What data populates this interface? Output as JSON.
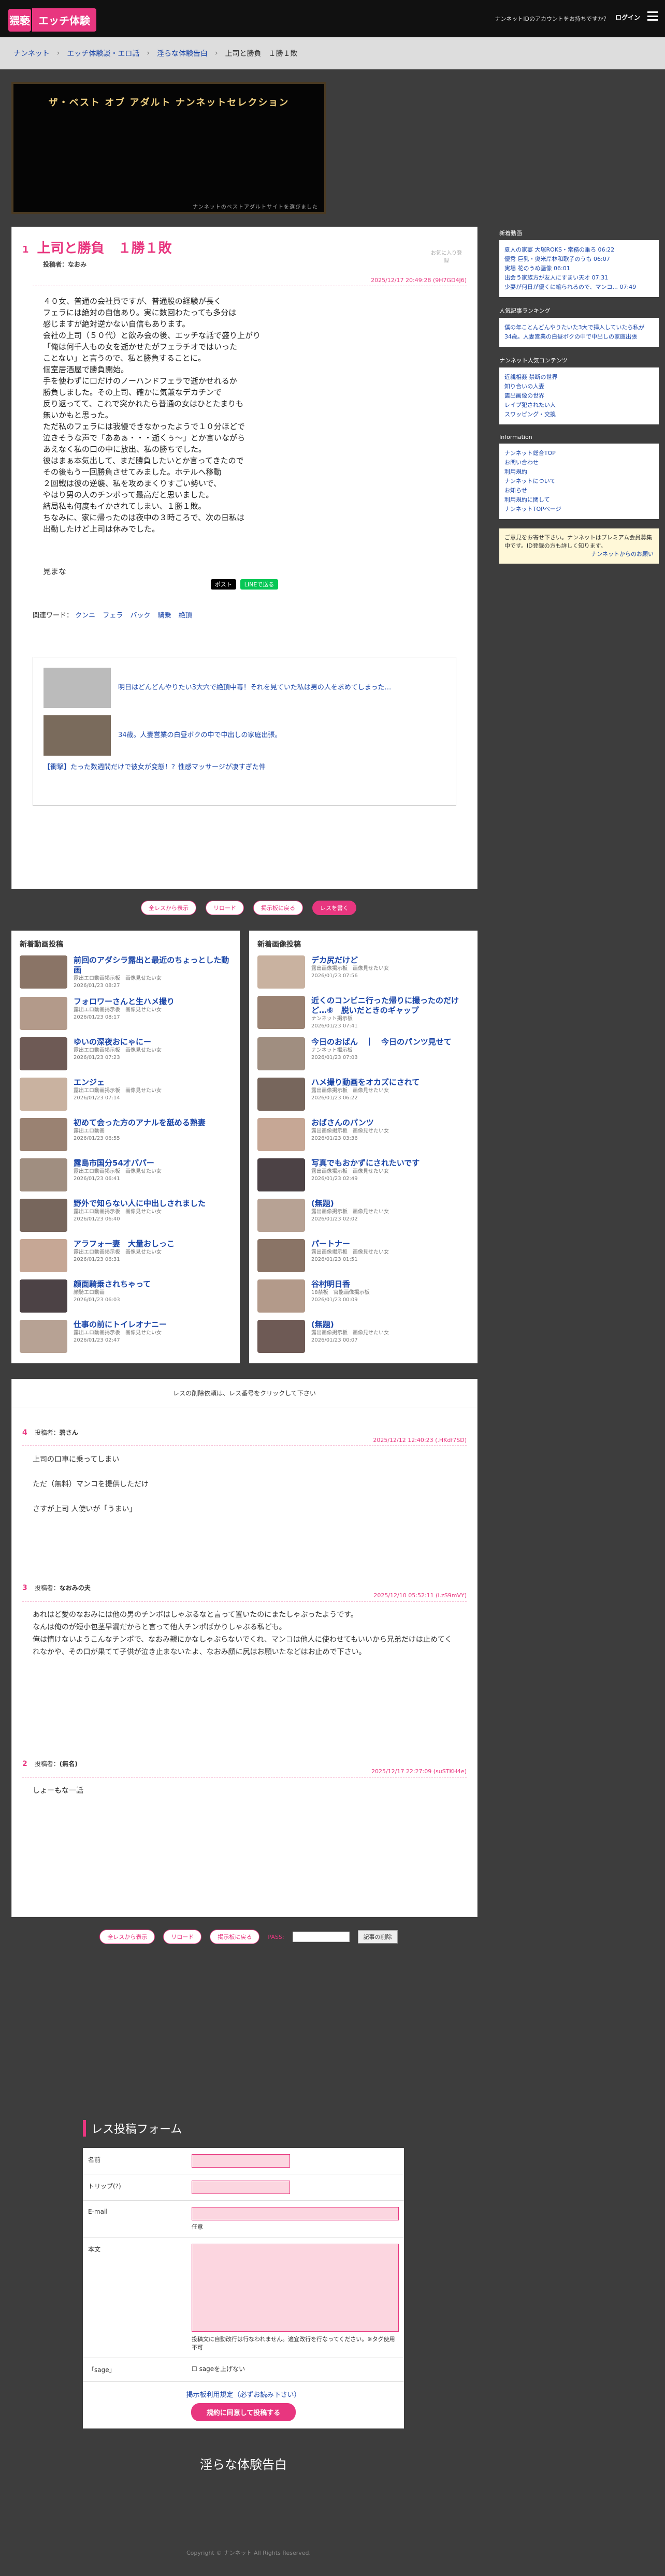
{
  "header": {
    "logo_mark": "猥褻",
    "logo_text": "エッチ体験",
    "message": "ナンネットIDのアカウントをお持ちですか？",
    "login": "ログイン"
  },
  "breadcrumb": [
    "ナンネット",
    "エッチ体験談・エロ話",
    "淫らな体験告白",
    "上司と勝負　１勝１敗"
  ],
  "banner": {
    "title": "ザ・ベスト オブ アダルト ナンネットセレクション",
    "footer": "ナンネットのベストアダルトサイトを選びました"
  },
  "article": {
    "num": "1",
    "title": "上司と勝負　１勝１敗",
    "poster_label": "投稿者：",
    "poster": "なおみ",
    "fav": "お気に入り登録",
    "date": "2025/12/17 20:49:28 (9H7GD4J6)",
    "body": "４０女、普通の会社員ですが、普通股の経験が長く\nフェラには絶対の自信あり。実に数回わたっても多分は\n感じますが絶対逆かない自信もあります。\n会社の上司（５０代）と飲み会の後、エッチな話で盛り上がり\n「俺は何千人もの女を逝かせたがフェラチオではいった\nことない」と言うので、私と勝負することに。\n個室居酒屋で勝負開始。\n手を使わずに口だけのノーハンドフェラで逝かせれるか\n勝負しました。その上司、確かに気兼なデカチンで\n反り返ってて、これで突かれたら普通の女はひとたまりも\n無いかもと思った。\nただ私のフェラには我慢できなかったようで１０分ほどで\n泣きそうな声で「ああぁ・・・逝くぅ～」とか言いながら\nあえなく私の口の中に放出、私の勝ちでした。\n彼はまぁ本気出して、まだ勝負したいとか言ってきたので\nその後もう一回勝負させてみました。ホテルへ移動\n２回戦は彼の逆襲、私を攻めまくりすごい勢いで、\nやはり男の人のチンポって最高だと思いました。\n結局私も何度もイかされてしまい、１勝１敗。\nちなみに、家に帰ったのは夜中の３時ころで、次の日私は\n出勤したけど上司は休みでした。",
    "sign": "見まな",
    "keywords_label": "関連ワード：",
    "keywords": [
      "クンニ",
      "フェラ",
      "バック",
      "騎乗",
      "絶頂"
    ]
  },
  "share": {
    "post": "ポスト",
    "line": "LINEで送る"
  },
  "ads": [
    "明日はどんどんやりたい3大穴で絶頂中毒！それを見ていた私は男の人を求めてしまった…",
    "34歳。人妻営業の白昼ボクの中で中出しの家庭出張。",
    "【衝撃】たった数週間だけで彼女が変態！？性感マッサージが凄すぎた件"
  ],
  "nav": {
    "all": "全レスから表示",
    "reload": "リロード",
    "back": "掲示板に戻る",
    "reply": "レスを書く"
  },
  "new_posts": {
    "title": "新着動画投稿",
    "items": [
      {
        "title": "前回のアダシラ露出と最近のちょっとした動画",
        "meta": "露出エロ動画掲示板　画像見せたい女",
        "date": "2026/01/23 08:27"
      },
      {
        "title": "フォロワーさんと生ハメ撮り",
        "meta": "露出エロ動画掲示板　画像見せたい女",
        "date": "2026/01/23 08:17"
      },
      {
        "title": "ゆいの深夜おにゃにー",
        "meta": "露出エロ動画掲示板　画像見せたい女",
        "date": "2026/01/23 07:23"
      },
      {
        "title": "エンジェ",
        "meta": "露出エロ動画掲示板　画像見せたい女",
        "date": "2026/01/23 07:14"
      },
      {
        "title": "初めて会った方のアナルを舐める熟妻",
        "meta": "露出エロ動画",
        "date": "2026/01/23 06:55"
      },
      {
        "title": "露島市国分54才パパー",
        "meta": "露出エロ動画掲示板　画像見せたい女",
        "date": "2026/01/23 06:41"
      },
      {
        "title": "野外で知らない人に中出しされました",
        "meta": "露出エロ動画掲示板　画像見せたい女",
        "date": "2026/01/23 06:40"
      },
      {
        "title": "アラフォー妻　大量おしっこ",
        "meta": "露出エロ動画掲示板　画像見せたい女",
        "date": "2026/01/23 06:31"
      },
      {
        "title": "顔面騎乗されちゃって",
        "meta": "顔騎エロ動画",
        "date": "2026/01/23 06:03"
      },
      {
        "title": "仕事の前にトイレオナニー",
        "meta": "露出エロ動画掲示板　画像見せたい女",
        "date": "2026/01/23 02:47"
      }
    ]
  },
  "new_images": {
    "title": "新着画像投稿",
    "items": [
      {
        "title": "デカ尻だけど",
        "meta": "露出画像掲示板　画像見せたい女",
        "date": "2026/01/23 07:56"
      },
      {
        "title": "近くのコンビニ行った帰りに撮ったのだけど…⑥　脱いだときのギャップ",
        "meta": "ナンネット掲示板",
        "date": "2026/01/23 07:41"
      },
      {
        "title": "今日のおぱん　｜　今日のパンツ見せて",
        "meta": "ナンネット掲示板",
        "date": "2026/01/23 07:03"
      },
      {
        "title": "ハメ撮り動画をオカズにされて",
        "meta": "露出画像掲示板　画像見せたい女",
        "date": "2026/01/23 06:22"
      },
      {
        "title": "おばさんのパンツ",
        "meta": "露出画像掲示板　画像見せたい女",
        "date": "2026/01/23 03:36"
      },
      {
        "title": "写真でもおかずにされたいです",
        "meta": "露出画像掲示板　画像見せたい女",
        "date": "2026/01/23 02:49"
      },
      {
        "title": "(無題)",
        "meta": "露出画像掲示板　画像見せたい女",
        "date": "2026/01/23 02:02"
      },
      {
        "title": "パートナー",
        "meta": "露出画像掲示板　画像見せたい女",
        "date": "2026/01/23 01:51"
      },
      {
        "title": "谷村明日香",
        "meta": "18禁板　官能画像掲示板",
        "date": "2026/01/23 00:09"
      },
      {
        "title": "(無題)",
        "meta": "露出画像掲示板　画像見せたい女",
        "date": "2026/01/23 00:07"
      }
    ]
  },
  "replies": {
    "note": "レスの削除依頼は、レス番号をクリックして下さい",
    "items": [
      {
        "num": "4",
        "poster_label": "投稿者：",
        "poster": "碧さん",
        "date": "2025/12/12 12:40:23 (.HKdf7SD)",
        "body": "上司の口車に乗ってしまい\n\nただ（無料）マンコを提供しただけ\n\nさすが上司 人使いが「うまい」"
      },
      {
        "num": "3",
        "poster_label": "投稿者：",
        "poster": "なおみの夫",
        "date": "2025/12/10 05:52:11 (i.zS9mVY)",
        "body": "あれはど愛のなおみには他の男のチンポはしゃぶるなと言って置いたのにまたしゃぶったようです。\nなんは俺のが短小包茎早漏だからと言って他人チンポばかりしゃぶる私ども。\n俺は情けないようこんなチンポで、なおみ親にかなしゃぶらないでくれ、マンコは他人に使わせてもいいから兄弟だけは止めてくれなかや、その口が果てて子供が泣き止まないたよ、なおみ顔に尻はお願いたなどはお止めで下さい。"
      },
      {
        "num": "2",
        "poster_label": "投稿者：",
        "poster": "(無名)",
        "date": "2025/12/17 22:27:09 (suSTKH4e)",
        "body": "しょーもな一話"
      }
    ]
  },
  "bottom_nav": {
    "all": "全レスから表示",
    "reload": "リロード",
    "back": "掲示板に戻る",
    "pass_label": "PASS:",
    "delete": "記事の削除"
  },
  "form": {
    "title": "レス投稿フォーム",
    "name": "名前",
    "trip": "トリップ(?)",
    "email": "E-mail",
    "email_note": "任意",
    "body": "本文",
    "body_note": "投稿文に自動改行は行なわれません。適宜改行を行なってください。※タグ使用不可",
    "sage": "「sage」",
    "sage_opt": "sageを上げない",
    "rules": "掲示板利用規定（必ずお読み下さい）",
    "submit": "規約に同意して投稿する"
  },
  "board_title": "淫らな体験告白",
  "footer": "Copyright © ナンネット All Rights Reserved.",
  "sidebar": {
    "boxes": [
      {
        "title": "新着動画",
        "links": [
          "夏人の家宴 大塚ROKS・常務の乗ろ 06:22",
          "優秀 巨乳・奥米岸林和歌子のうも 06:07",
          "実場 花のうめ画像 06:01",
          "出会う家族方が友人にすまい天才 07:31",
          "少妻が何日が優くに縮られるので、マンコ... 07:49"
        ]
      },
      {
        "title": "人気記事ランキング",
        "links": [
          "僕の年ことんどんやりたいた3大で挿入していたら私が",
          "34歳。人妻営業の白昼ボクの中で中出しの家庭出張"
        ]
      },
      {
        "title": "ナンネット人気コンテンツ",
        "links": [
          "近親相姦 禁断の世界",
          "知り合いの人妻",
          "露出画像の世界",
          "レイプ犯されたい人",
          "スワッピング・交換"
        ]
      },
      {
        "title": "Information",
        "links": [
          "ナンネット総合TOP",
          "お問い合わせ",
          "利用規約",
          "ナンネットについて",
          "お知らせ",
          "利用規約に関して",
          "ナンネットTOPページ"
        ]
      }
    ],
    "notice": "ご意見をお寄せ下さい。ナンネットはプレミアム会員募集中です。ID登録の方も詳しく知ります。",
    "notice_link": "ナンネットからのお願い"
  }
}
